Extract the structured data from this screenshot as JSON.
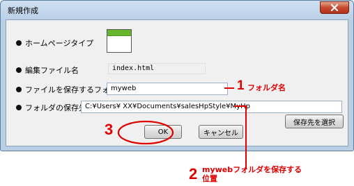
{
  "window": {
    "title": "新規作成"
  },
  "rows": {
    "homepage_type": {
      "label": "ホームページタイプ"
    },
    "edit_file": {
      "label": "編集ファイル名",
      "value": "index.html"
    },
    "save_folder_name": {
      "label": "ファイルを保存するフォルダ名",
      "value": "myweb"
    },
    "save_location": {
      "label": "フォルダの保存先",
      "value": "C:¥Users¥ XX¥Documents¥salesHpStyle¥MyHp"
    }
  },
  "buttons": {
    "select_location": "保存先を選択",
    "ok": "OK",
    "cancel": "キャンセル"
  },
  "annotations": {
    "one": {
      "number": "1",
      "text": "フォルダ名"
    },
    "two": {
      "number": "2",
      "line1": "mywebフォルダを保存する",
      "line2": "位置"
    },
    "three": {
      "number": "3"
    }
  },
  "colors": {
    "annotation": "#e00000",
    "thumbnail_header": "#66b72c",
    "close_button": "#c54b2f"
  }
}
